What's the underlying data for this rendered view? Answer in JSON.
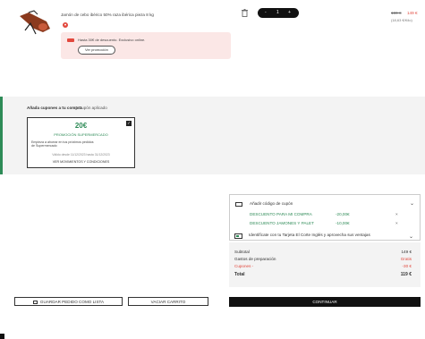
{
  "product": {
    "name": "Jamón de cebo ibérico 50% raza ibérica pieza 8 kg",
    "image_icon": "ham-leg-image",
    "promo_text": "Hasta 30€ de descuento. Exclusivo online.",
    "promo_button": "Ver promoción",
    "quantity": {
      "minus": "-",
      "value": "1",
      "plus": "+"
    },
    "price_old": "169 €",
    "price_new": "149 €",
    "price_per_kg": "(18,63 €/Kilo)"
  },
  "coupons": {
    "title": "Añada cupones a tu compra",
    "applied": "1 Cupón aplicado",
    "card": {
      "amount": "20€",
      "name": "PROMOCIÓN SUPERMERCADO",
      "description": "Empieza a ahorrar en tus próximos pedidos de Supermercado",
      "validity": "Válido desde 11/12/2023 hasta 31/12/2023",
      "link": "VER MOVIMIENTOS Y CONDICIONES"
    }
  },
  "code_panel": {
    "label": "Añadir código de cupón",
    "discounts": [
      {
        "name": "DESCUENTO PARA MI COMPRA",
        "amount": "-20,00€",
        "remove": "×"
      },
      {
        "name": "DESCUENTO JAMONES Y PALET",
        "amount": "-10,00€",
        "remove": "×"
      }
    ],
    "id_text": "Identifícate con tu Tarjeta El Corte Inglés y aprovecha sus ventajas"
  },
  "summary": {
    "subtotal_label": "Subtotal",
    "subtotal_value": "149 €",
    "prep_label": "Gastos de preparación",
    "prep_value": "Gratis",
    "coupons_label": "Cupones -",
    "coupons_value": "-30 €",
    "total_label": "Total",
    "total_value": "119 €"
  },
  "buttons": {
    "save": "GUARDAR PEDIDO COMO LISTA",
    "empty": "VACIAR CARRITO",
    "continue": "CONTINUAR"
  },
  "colors": {
    "accent_red": "#e2483d",
    "accent_green": "#2e8b57",
    "dark": "#111111"
  }
}
